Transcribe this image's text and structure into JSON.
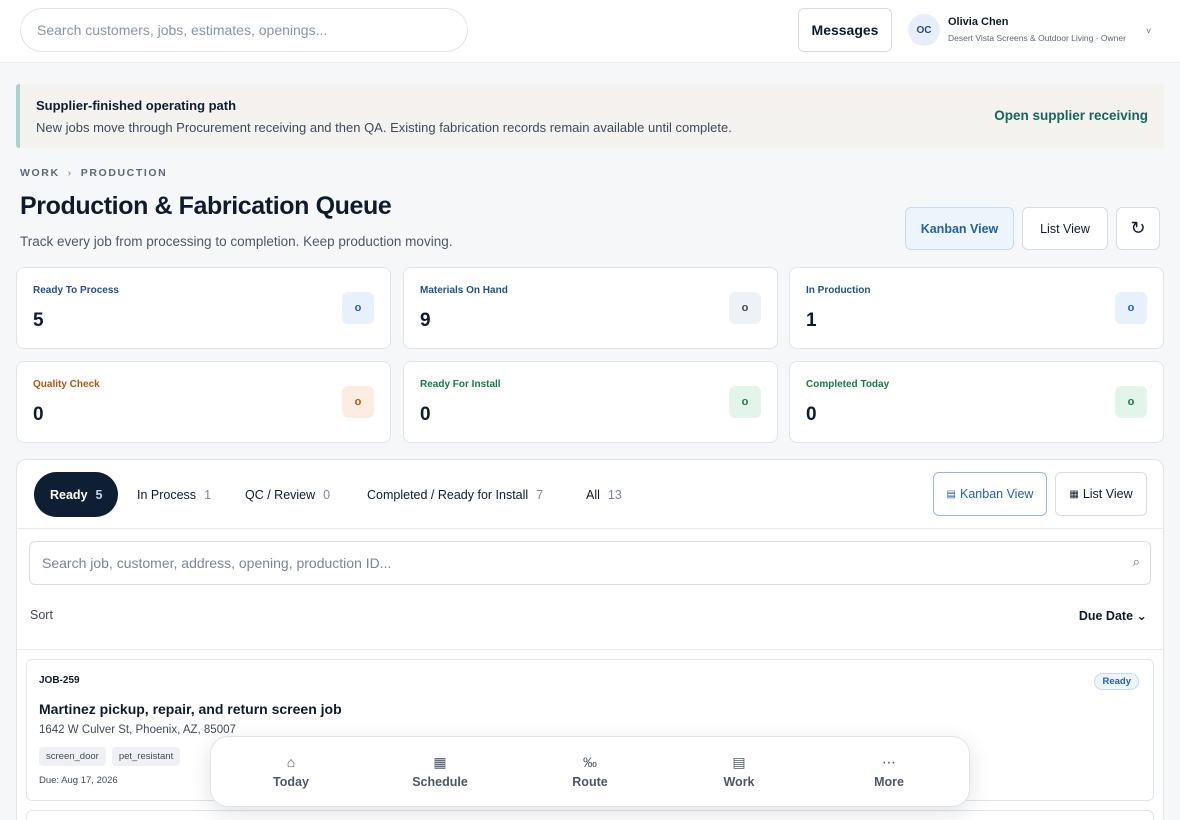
{
  "topbar": {
    "search_placeholder": "Search customers, jobs, estimates, openings...",
    "messages_label": "Messages",
    "user": {
      "initials": "OC",
      "name": "Olivia Chen",
      "org": "Desert Vista Screens & Outdoor Living · Owner",
      "chevron": "˅"
    }
  },
  "banner": {
    "title": "Supplier-finished operating path",
    "text": "New jobs move through Procurement receiving and then QA. Existing fabrication records remain available until complete.",
    "link": "Open supplier receiving"
  },
  "breadcrumb": {
    "root": "WORK",
    "separator": "›",
    "current": "PRODUCTION"
  },
  "header": {
    "title": "Production & Fabrication Queue",
    "subtitle": "Track every job from processing to completion. Keep production moving.",
    "kanban_label": "Kanban View",
    "list_label": "List View",
    "refresh_icon": "↻"
  },
  "stats": [
    {
      "label": "Ready To Process",
      "value": "5",
      "icon": "o",
      "color": "#1f4f8f",
      "icon_bg": "#e8f0fb",
      "icon_color": "#1f5fb4"
    },
    {
      "label": "Materials On Hand",
      "value": "9",
      "icon": "o",
      "color": "#1f4f8f",
      "icon_bg": "#eef1f5",
      "icon_color": "#3f4a59"
    },
    {
      "label": "In Production",
      "value": "1",
      "icon": "o",
      "color": "#1f4f8f",
      "icon_bg": "#e8f0fb",
      "icon_color": "#1f5fb4"
    },
    {
      "label": "Quality Check",
      "value": "0",
      "icon": "o",
      "color": "#b8520f",
      "icon_bg": "#fdece2",
      "icon_color": "#b8520f"
    },
    {
      "label": "Ready For Install",
      "value": "0",
      "icon": "o",
      "color": "#177a45",
      "icon_bg": "#e3f4ea",
      "icon_color": "#177a45"
    },
    {
      "label": "Completed Today",
      "value": "0",
      "icon": "o",
      "color": "#177a45",
      "icon_bg": "#e3f4ea",
      "icon_color": "#177a45"
    }
  ],
  "queue": {
    "tabs": [
      {
        "label": "Ready",
        "count": "5"
      },
      {
        "label": "In Process",
        "count": "1"
      },
      {
        "label": "QC / Review",
        "count": "0"
      },
      {
        "label": "Completed / Ready for Install",
        "count": "7"
      },
      {
        "label": "All",
        "count": "13"
      }
    ],
    "kanban_label": "Kanban View",
    "list_label": "List View",
    "kanban_icon": "▤",
    "list_icon": "▦",
    "search_placeholder": "Search job, customer, address, opening, production ID...",
    "search_icon": "⌕",
    "sort_label": "Sort",
    "sort_value": "Due Date",
    "sort_chevron": "⌄",
    "jobs": [
      {
        "id": "JOB-259",
        "status": "Ready",
        "title": "Martinez pickup, repair, and return screen job",
        "address": "1642 W Culver St, Phoenix, AZ, 85007",
        "tags": [
          "screen_door",
          "pet_resistant"
        ],
        "due": "Due: Aug 17, 2026"
      }
    ]
  },
  "bottom_nav": [
    {
      "label": "Today",
      "icon": "⌂"
    },
    {
      "label": "Schedule",
      "icon": "▦"
    },
    {
      "label": "Route",
      "icon": "‰"
    },
    {
      "label": "Work",
      "icon": "▤"
    },
    {
      "label": "More",
      "icon": "⋯"
    }
  ]
}
